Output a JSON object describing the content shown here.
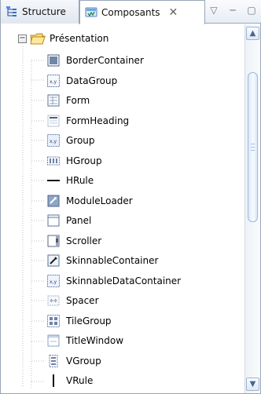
{
  "tabs": {
    "structure": {
      "label": "Structure",
      "icon": "structure-icon"
    },
    "composants": {
      "label": "Composants",
      "icon": "components-icon",
      "close_icon": "close-icon"
    }
  },
  "window_controls": [
    {
      "icon": "view-menu-icon"
    },
    {
      "icon": "minimize-icon"
    },
    {
      "icon": "maximize-icon"
    }
  ],
  "tree": {
    "root": {
      "label": "Présentation",
      "expanded": true,
      "icon": "folder-icon"
    },
    "items": [
      {
        "label": "BorderContainer",
        "icon": "border-container-icon"
      },
      {
        "label": "DataGroup",
        "icon": "data-group-icon"
      },
      {
        "label": "Form",
        "icon": "form-icon"
      },
      {
        "label": "FormHeading",
        "icon": "form-heading-icon"
      },
      {
        "label": "Group",
        "icon": "group-icon"
      },
      {
        "label": "HGroup",
        "icon": "hgroup-icon"
      },
      {
        "label": "HRule",
        "icon": "hrule-icon"
      },
      {
        "label": "ModuleLoader",
        "icon": "module-loader-icon"
      },
      {
        "label": "Panel",
        "icon": "panel-icon"
      },
      {
        "label": "Scroller",
        "icon": "scroller-icon"
      },
      {
        "label": "SkinnableContainer",
        "icon": "skinnable-container-icon"
      },
      {
        "label": "SkinnableDataContainer",
        "icon": "skinnable-data-container-icon"
      },
      {
        "label": "Spacer",
        "icon": "spacer-icon"
      },
      {
        "label": "TileGroup",
        "icon": "tile-group-icon"
      },
      {
        "label": "TitleWindow",
        "icon": "title-window-icon"
      },
      {
        "label": "VGroup",
        "icon": "vgroup-icon"
      },
      {
        "label": "VRule",
        "icon": "vrule-icon"
      }
    ]
  },
  "scrollbar": {
    "up_icon": "scroll-up-icon",
    "down_icon": "scroll-down-icon"
  },
  "colors": {
    "panel_border": "#9aa6b8",
    "scroll_accent": "#9fb9dc",
    "tree_line": "#b7b7b7"
  }
}
